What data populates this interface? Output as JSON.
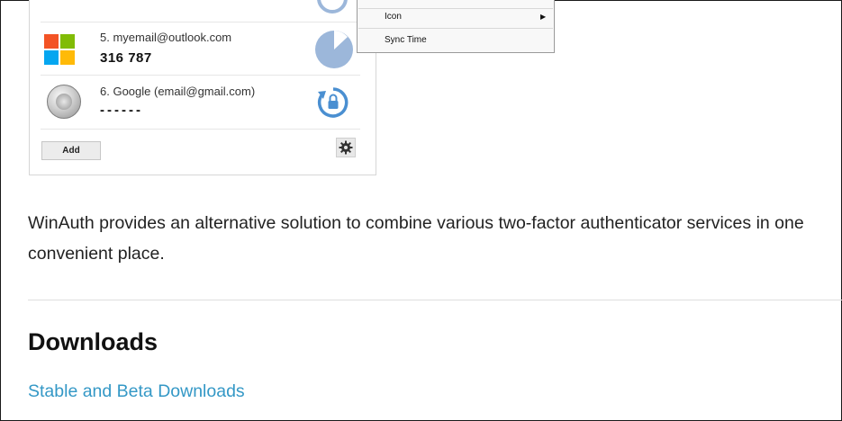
{
  "authenticator": {
    "accounts": [
      {
        "index_label": "5. myemail@outlook.com",
        "code": "316 787",
        "icon": "microsoft-logo-icon",
        "timer": "countdown-pie-icon"
      },
      {
        "index_label": "6. Google (email@gmail.com)",
        "code": "------",
        "icon": "google-authenticator-icon",
        "timer": "refresh-lock-icon"
      }
    ],
    "add_label": "Add",
    "settings_icon": "gear-icon"
  },
  "context_menu": {
    "items": [
      {
        "label": "Icon",
        "has_submenu": true
      },
      {
        "label": "Sync Time",
        "has_submenu": false
      }
    ]
  },
  "article": {
    "description": "WinAuth provides an alternative solution to combine various two-factor authenticator services in one convenient place.",
    "section_heading": "Downloads",
    "download_link": "Stable and Beta Downloads"
  },
  "colors": {
    "link": "#3498c6",
    "timer_blue": "#9cb7da",
    "ms_red": "#f35325",
    "ms_green": "#81bc06",
    "ms_blue": "#05a6f0",
    "ms_yellow": "#ffba08"
  }
}
